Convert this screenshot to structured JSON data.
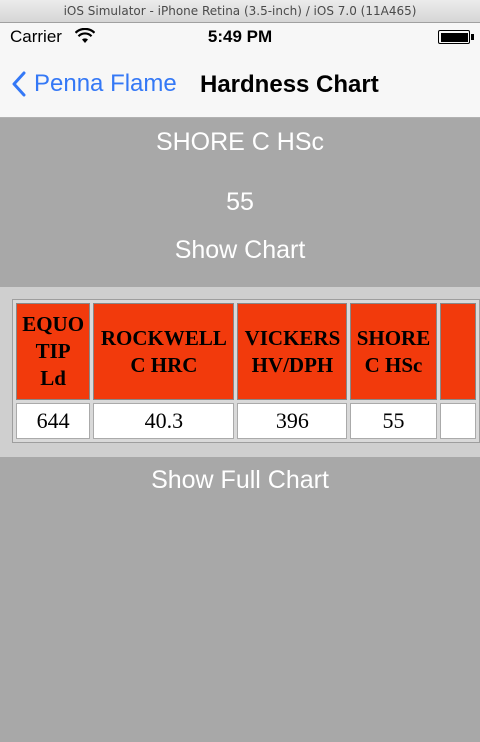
{
  "window": {
    "title": "iOS Simulator - iPhone Retina (3.5-inch) / iOS 7.0 (11A465)"
  },
  "status": {
    "carrier": "Carrier",
    "time": "5:49 PM",
    "icons": [
      "wifi-icon",
      "battery-icon"
    ]
  },
  "nav": {
    "back_label": "Penna Flame",
    "title": "Hardness Chart",
    "back_icon": "chevron-left-icon",
    "tint": "#3478f6"
  },
  "main": {
    "scale_label": "SHORE C HSc",
    "value": "55",
    "show_chart_label": "Show  Chart",
    "show_full_chart_label": "Show Full Chart"
  },
  "table": {
    "header_color": "#f23a0c",
    "columns": [
      {
        "label": "EQUOTIP Ld",
        "lines": [
          "EQUO",
          "TIP",
          "Ld"
        ]
      },
      {
        "label": "ROCKWELL C HRC",
        "lines": [
          "ROCKWELL",
          "C HRC"
        ]
      },
      {
        "label": "VICKERS HV/DPH",
        "lines": [
          "VICKERS",
          "HV/DPH"
        ]
      },
      {
        "label": "SHORE C HSc",
        "lines": [
          "SHORE",
          "C HSc"
        ]
      },
      {
        "label": "",
        "lines": []
      }
    ],
    "row": [
      "644",
      "40.3",
      "396",
      "55",
      ""
    ]
  }
}
